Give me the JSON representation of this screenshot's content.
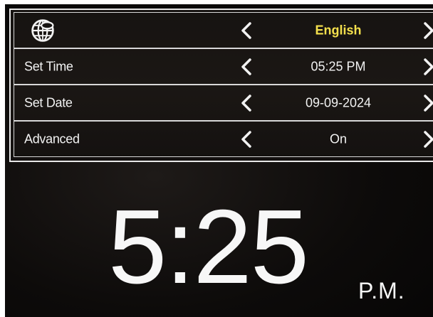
{
  "menu": {
    "language": {
      "icon": "globe-icon",
      "value": "English"
    },
    "set_time": {
      "label": "Set Time",
      "value": "05:25 PM"
    },
    "set_date": {
      "label": "Set Date",
      "value": "09-09-2024"
    },
    "advanced": {
      "label": "Advanced",
      "value": "On"
    },
    "nav": {
      "left_icon": "chevron-left-icon",
      "right_icon": "chevron-right-icon"
    }
  },
  "clock": {
    "time": "5:25",
    "period": "P.M."
  },
  "colors": {
    "accent_language": "#f4e04d",
    "text": "#f2f2f2",
    "border": "#e8e8e8"
  }
}
